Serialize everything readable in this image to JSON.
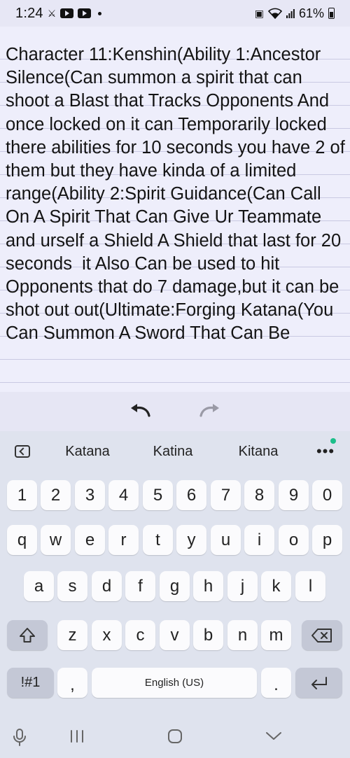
{
  "status_bar": {
    "time": "1:24",
    "battery": "61%"
  },
  "note": {
    "text": "Character 11:Kenshin(Ability 1:Ancestor Silence(Can summon a spirit that can shoot a Blast that Tracks Opponents And once locked on it can Temporarily locked there abilities for 10 seconds you have 2 of them but they have kinda of a limited range(Ability 2:Spirit Guidance(Can Call On A Spirit That Can Give Ur Teammate and urself a Shield A Shield that last for 20 seconds  it Also Can be used to hit Opponents that do 7 damage,but it can be shot out out(Ultimate:Forging Katana(You Can Summon A Sword That Can Be"
  },
  "toolbar": {
    "undo": "undo-icon",
    "redo": "redo-icon"
  },
  "keyboard": {
    "suggestions": [
      "Katana",
      "Katina",
      "Kitana"
    ],
    "more_label": "•••",
    "numbers": [
      "1",
      "2",
      "3",
      "4",
      "5",
      "6",
      "7",
      "8",
      "9",
      "0"
    ],
    "row1": [
      "q",
      "w",
      "e",
      "r",
      "t",
      "y",
      "u",
      "i",
      "o",
      "p"
    ],
    "row2": [
      "a",
      "s",
      "d",
      "f",
      "g",
      "h",
      "j",
      "k",
      "l"
    ],
    "row3": [
      "z",
      "x",
      "c",
      "v",
      "b",
      "n",
      "m"
    ],
    "symbols_label": "!#1",
    "comma_label": ",",
    "space_label": "English (US)",
    "period_label": "."
  },
  "colors": {
    "accent_dot": "#1dbf8a",
    "note_background": "#eeeefb"
  }
}
